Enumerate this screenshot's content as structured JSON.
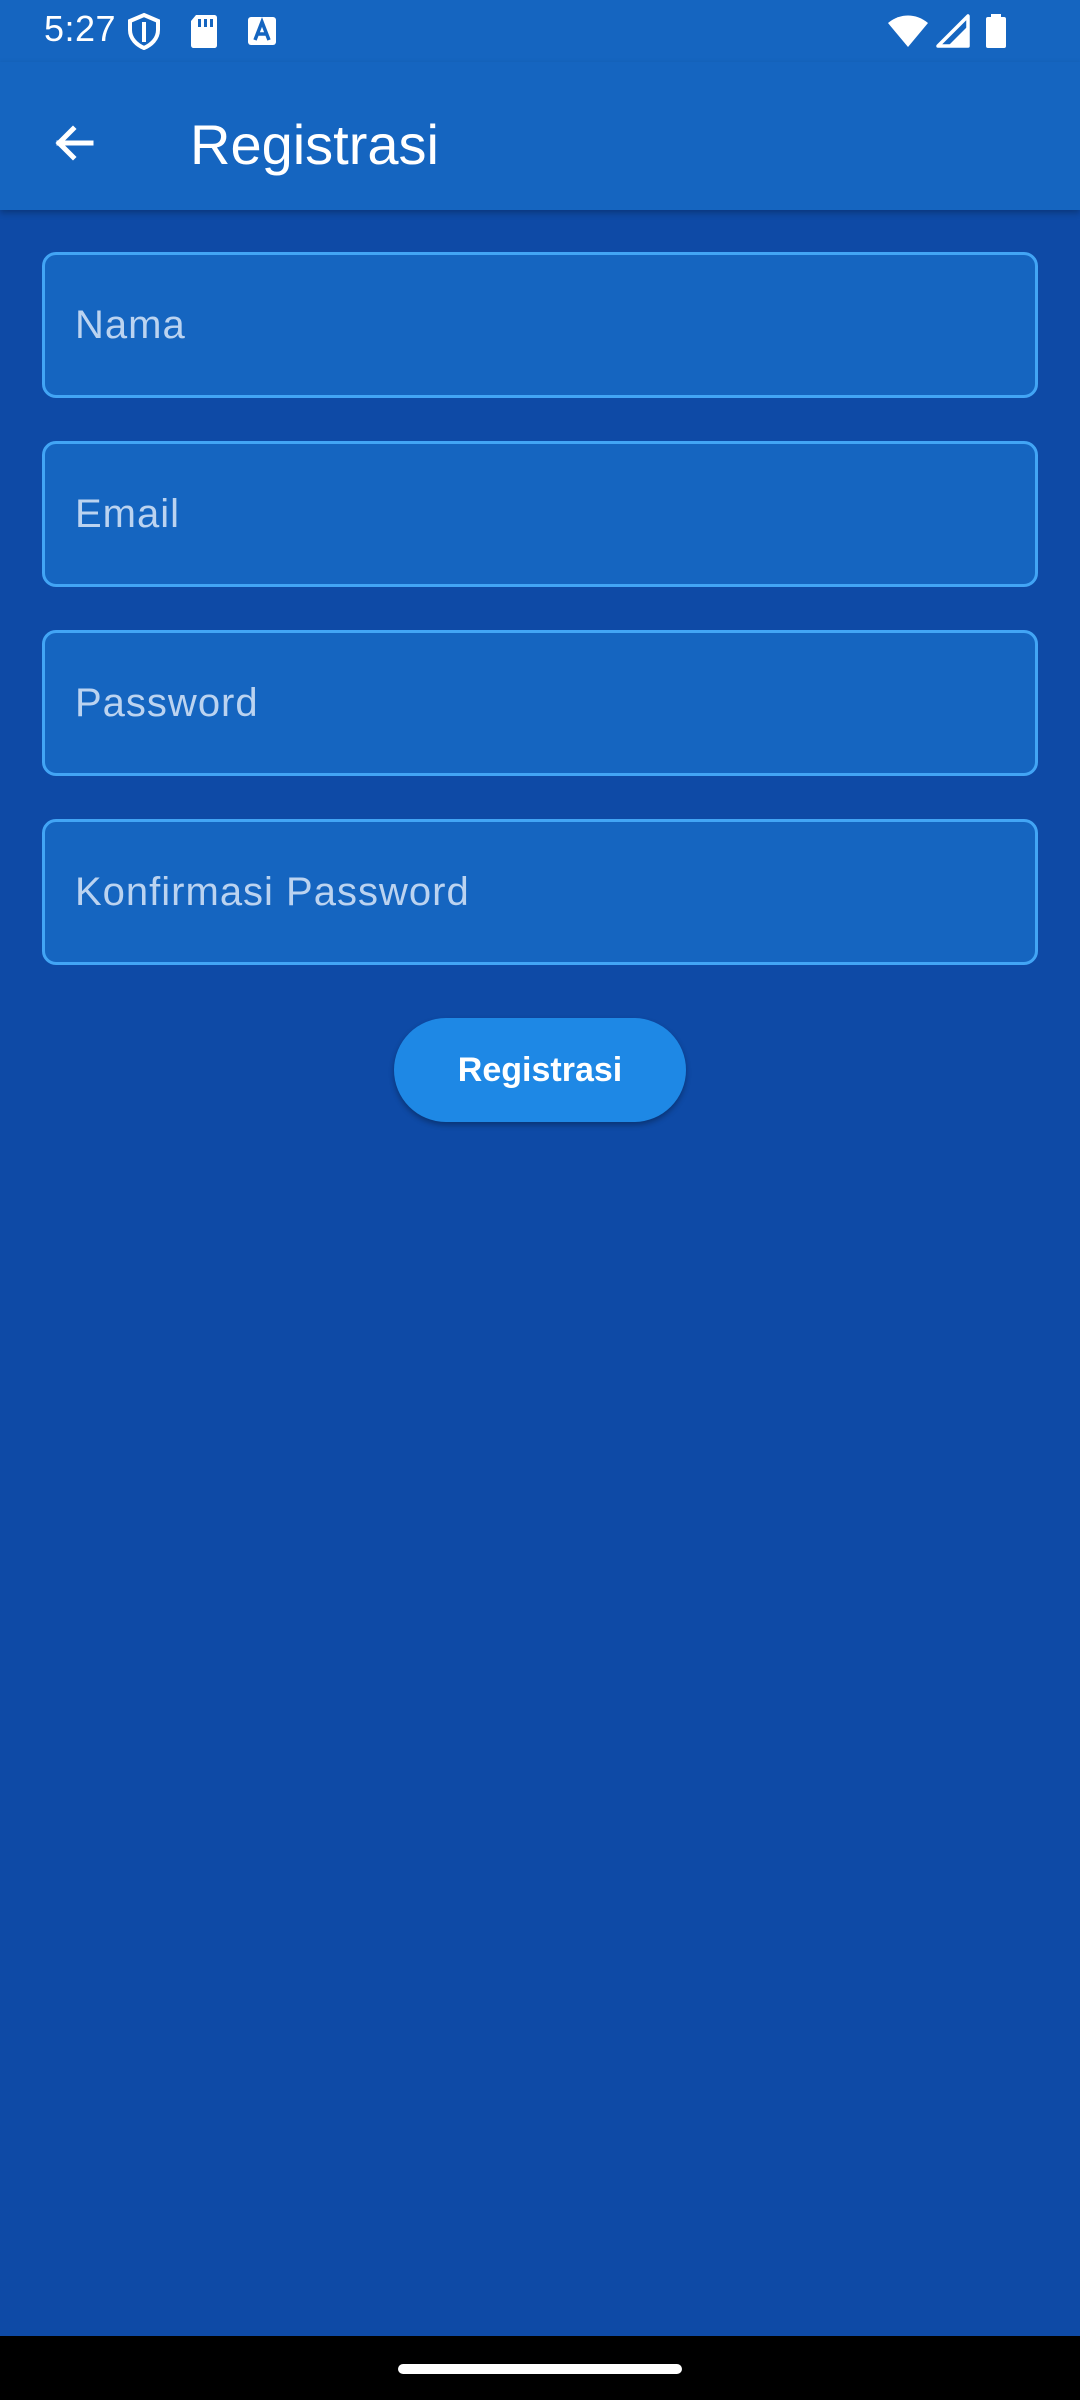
{
  "status_bar": {
    "time": "5:27",
    "left_icons": [
      "shield-icon",
      "sd-card-icon",
      "keyboard-a-icon"
    ],
    "right_icons": [
      "wifi-icon",
      "signal-icon",
      "battery-icon"
    ]
  },
  "app_bar": {
    "title": "Registrasi",
    "back_icon": "arrow-back-icon"
  },
  "form": {
    "nama": {
      "placeholder": "Nama",
      "value": ""
    },
    "email": {
      "placeholder": "Email",
      "value": ""
    },
    "password": {
      "placeholder": "Password",
      "value": ""
    },
    "konfirmasi_password": {
      "placeholder": "Konfirmasi Password",
      "value": ""
    }
  },
  "actions": {
    "register_label": "Registrasi"
  },
  "colors": {
    "background": "#0E4AA6",
    "app_bar": "#1565C0",
    "field_fill": "#1565C0",
    "field_border": "#42A5F5",
    "button": "#1E88E5",
    "placeholder": "#BBD3F0"
  }
}
